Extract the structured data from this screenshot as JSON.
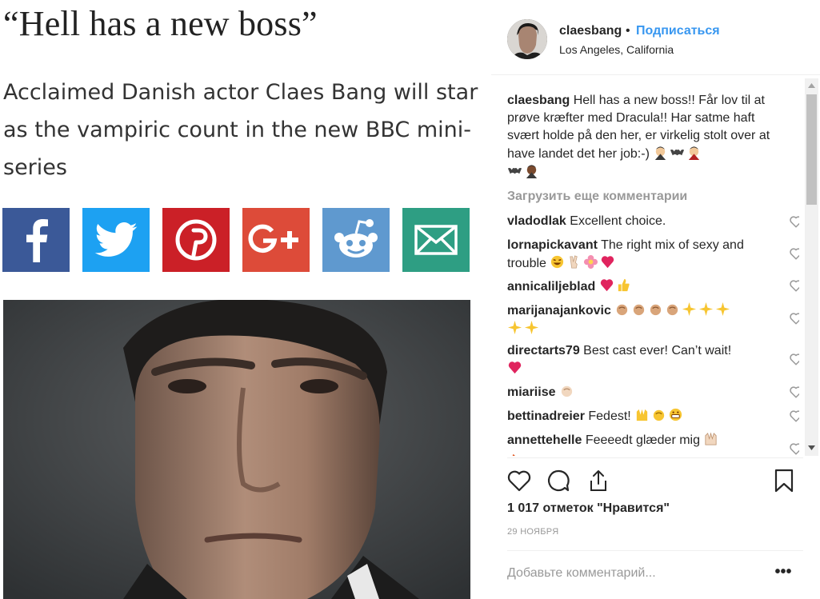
{
  "article": {
    "headline": "“Hell has a new boss”",
    "subhead": "Acclaimed Danish actor Claes Bang will star as the vampiric count in the new BBC mini-series",
    "share_buttons": [
      {
        "network": "facebook",
        "icon": "facebook-icon",
        "color": "#3b5998"
      },
      {
        "network": "twitter",
        "icon": "twitter-icon",
        "color": "#1da1f2"
      },
      {
        "network": "pinterest",
        "icon": "pinterest-icon",
        "color": "#cb2027"
      },
      {
        "network": "google-plus",
        "icon": "google-plus-icon",
        "color": "#dd4b39"
      },
      {
        "network": "reddit",
        "icon": "reddit-icon",
        "color": "#5f99cf"
      },
      {
        "network": "email",
        "icon": "mail-icon",
        "color": "#2e9e83"
      }
    ]
  },
  "post": {
    "username": "claesbang",
    "separator": "•",
    "follow_label": "Подписаться",
    "location": "Los Angeles, California",
    "caption": {
      "username": "claesbang",
      "text": "Hell has a new boss!! Får lov til at prøve kræfter med Dracula!! Har satme haft svært holde på den her, er virkelig stolt over at have landet det her job:-)"
    },
    "load_more_label": "Загрузить еще комментарии",
    "comments": [
      {
        "username": "vladodlak",
        "text": "Excellent choice."
      },
      {
        "username": "lornapickavant",
        "text": "The right mix of sexy and trouble"
      },
      {
        "username": "annicaliljeblad",
        "text": ""
      },
      {
        "username": "marijanajankovic",
        "text": ""
      },
      {
        "username": "directarts79",
        "text": "Best cast ever! Can’t wait!"
      },
      {
        "username": "miariise",
        "text": ""
      },
      {
        "username": "bettinadreier",
        "text": "Fedest!"
      },
      {
        "username": "annettehelle",
        "text": "Feeeedt glæder mig"
      }
    ],
    "likes_label": "1 017 отметок \"Нравится\"",
    "date_label": "29 НОЯБРЯ",
    "comment_placeholder": "Добавьте комментарий...",
    "more_options_label": "•••",
    "colors": {
      "link": "#3897f0",
      "muted": "#999999",
      "text": "#262626"
    }
  }
}
